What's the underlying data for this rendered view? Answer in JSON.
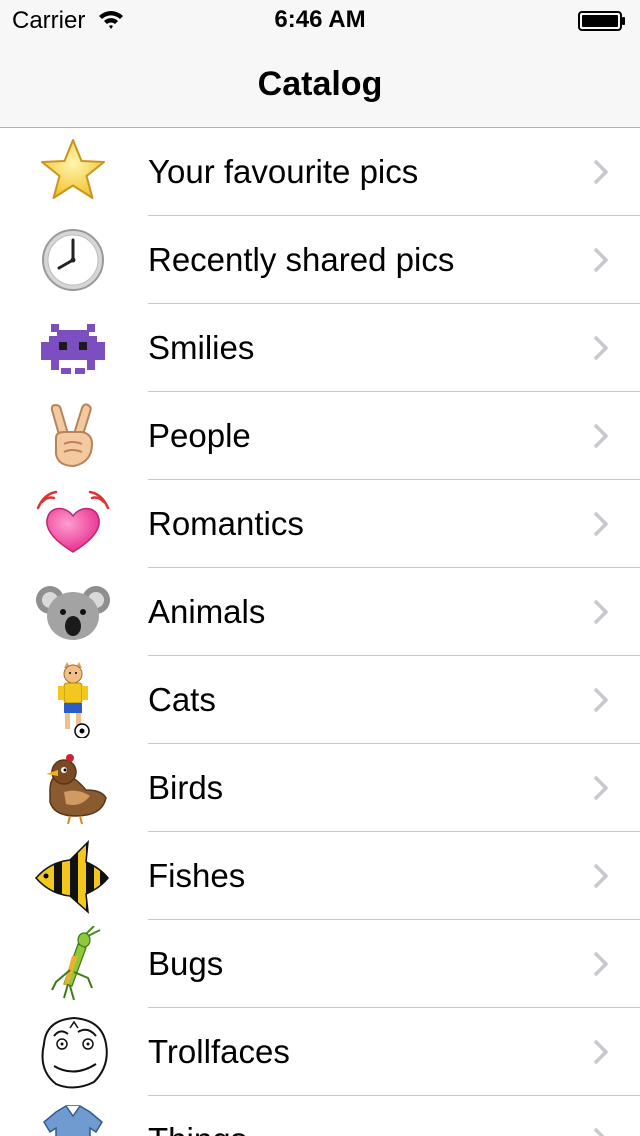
{
  "status_bar": {
    "carrier": "Carrier",
    "time": "6:46 AM"
  },
  "nav": {
    "title": "Catalog"
  },
  "catalog": {
    "items": [
      {
        "label": "Your favourite pics",
        "icon": "star-icon"
      },
      {
        "label": "Recently shared pics",
        "icon": "clock-icon"
      },
      {
        "label": "Smilies",
        "icon": "space-invader-icon"
      },
      {
        "label": "People",
        "icon": "victory-hand-icon"
      },
      {
        "label": "Romantics",
        "icon": "vibrating-heart-icon"
      },
      {
        "label": "Animals",
        "icon": "koala-icon"
      },
      {
        "label": "Cats",
        "icon": "cat-footballer-icon"
      },
      {
        "label": "Birds",
        "icon": "bird-icon"
      },
      {
        "label": "Fishes",
        "icon": "angelfish-icon"
      },
      {
        "label": "Bugs",
        "icon": "grasshopper-icon"
      },
      {
        "label": "Trollfaces",
        "icon": "trollface-icon"
      },
      {
        "label": "Things",
        "icon": "shirt-icon"
      }
    ]
  },
  "colors": {
    "bar_background": "#f7f7f7",
    "separator": "#c8c7cc",
    "chevron": "#c7c7cc"
  }
}
